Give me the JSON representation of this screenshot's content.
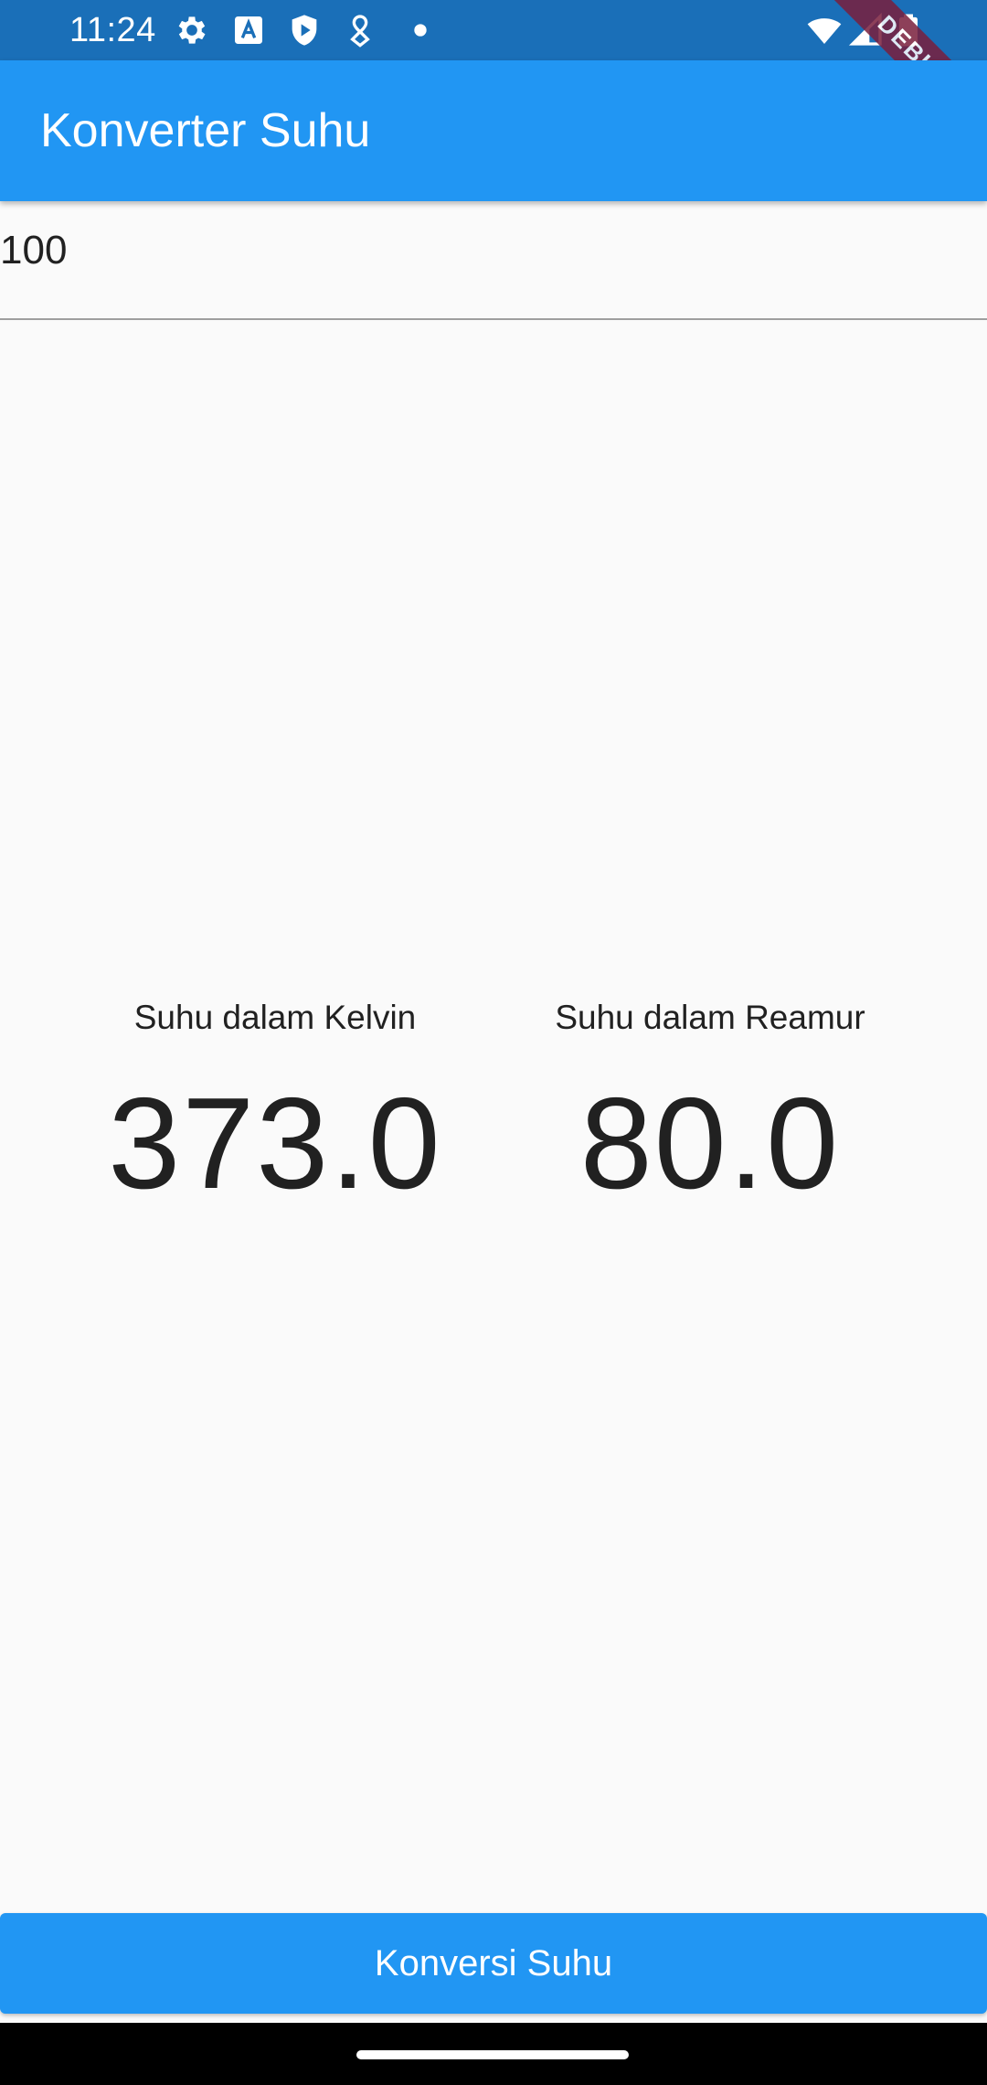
{
  "status_bar": {
    "time": "11:24",
    "left_icons": [
      "settings-icon",
      "a-notification-icon",
      "shield-play-icon",
      "location-heart-icon",
      "dot-icon"
    ],
    "right_icons": [
      "wifi-icon",
      "signal-icon",
      "battery-icon"
    ],
    "background": "#1a6fb8"
  },
  "debug_banner": {
    "label": "DEBUG"
  },
  "app_bar": {
    "title": "Konverter Suhu",
    "background": "#2196f3"
  },
  "input": {
    "value": "100"
  },
  "results": {
    "kelvin": {
      "label": "Suhu dalam Kelvin",
      "value": "373.0"
    },
    "reamur": {
      "label": "Suhu dalam Reamur",
      "value": "80.0"
    }
  },
  "button": {
    "label": "Konversi Suhu",
    "background": "#2196f3"
  }
}
